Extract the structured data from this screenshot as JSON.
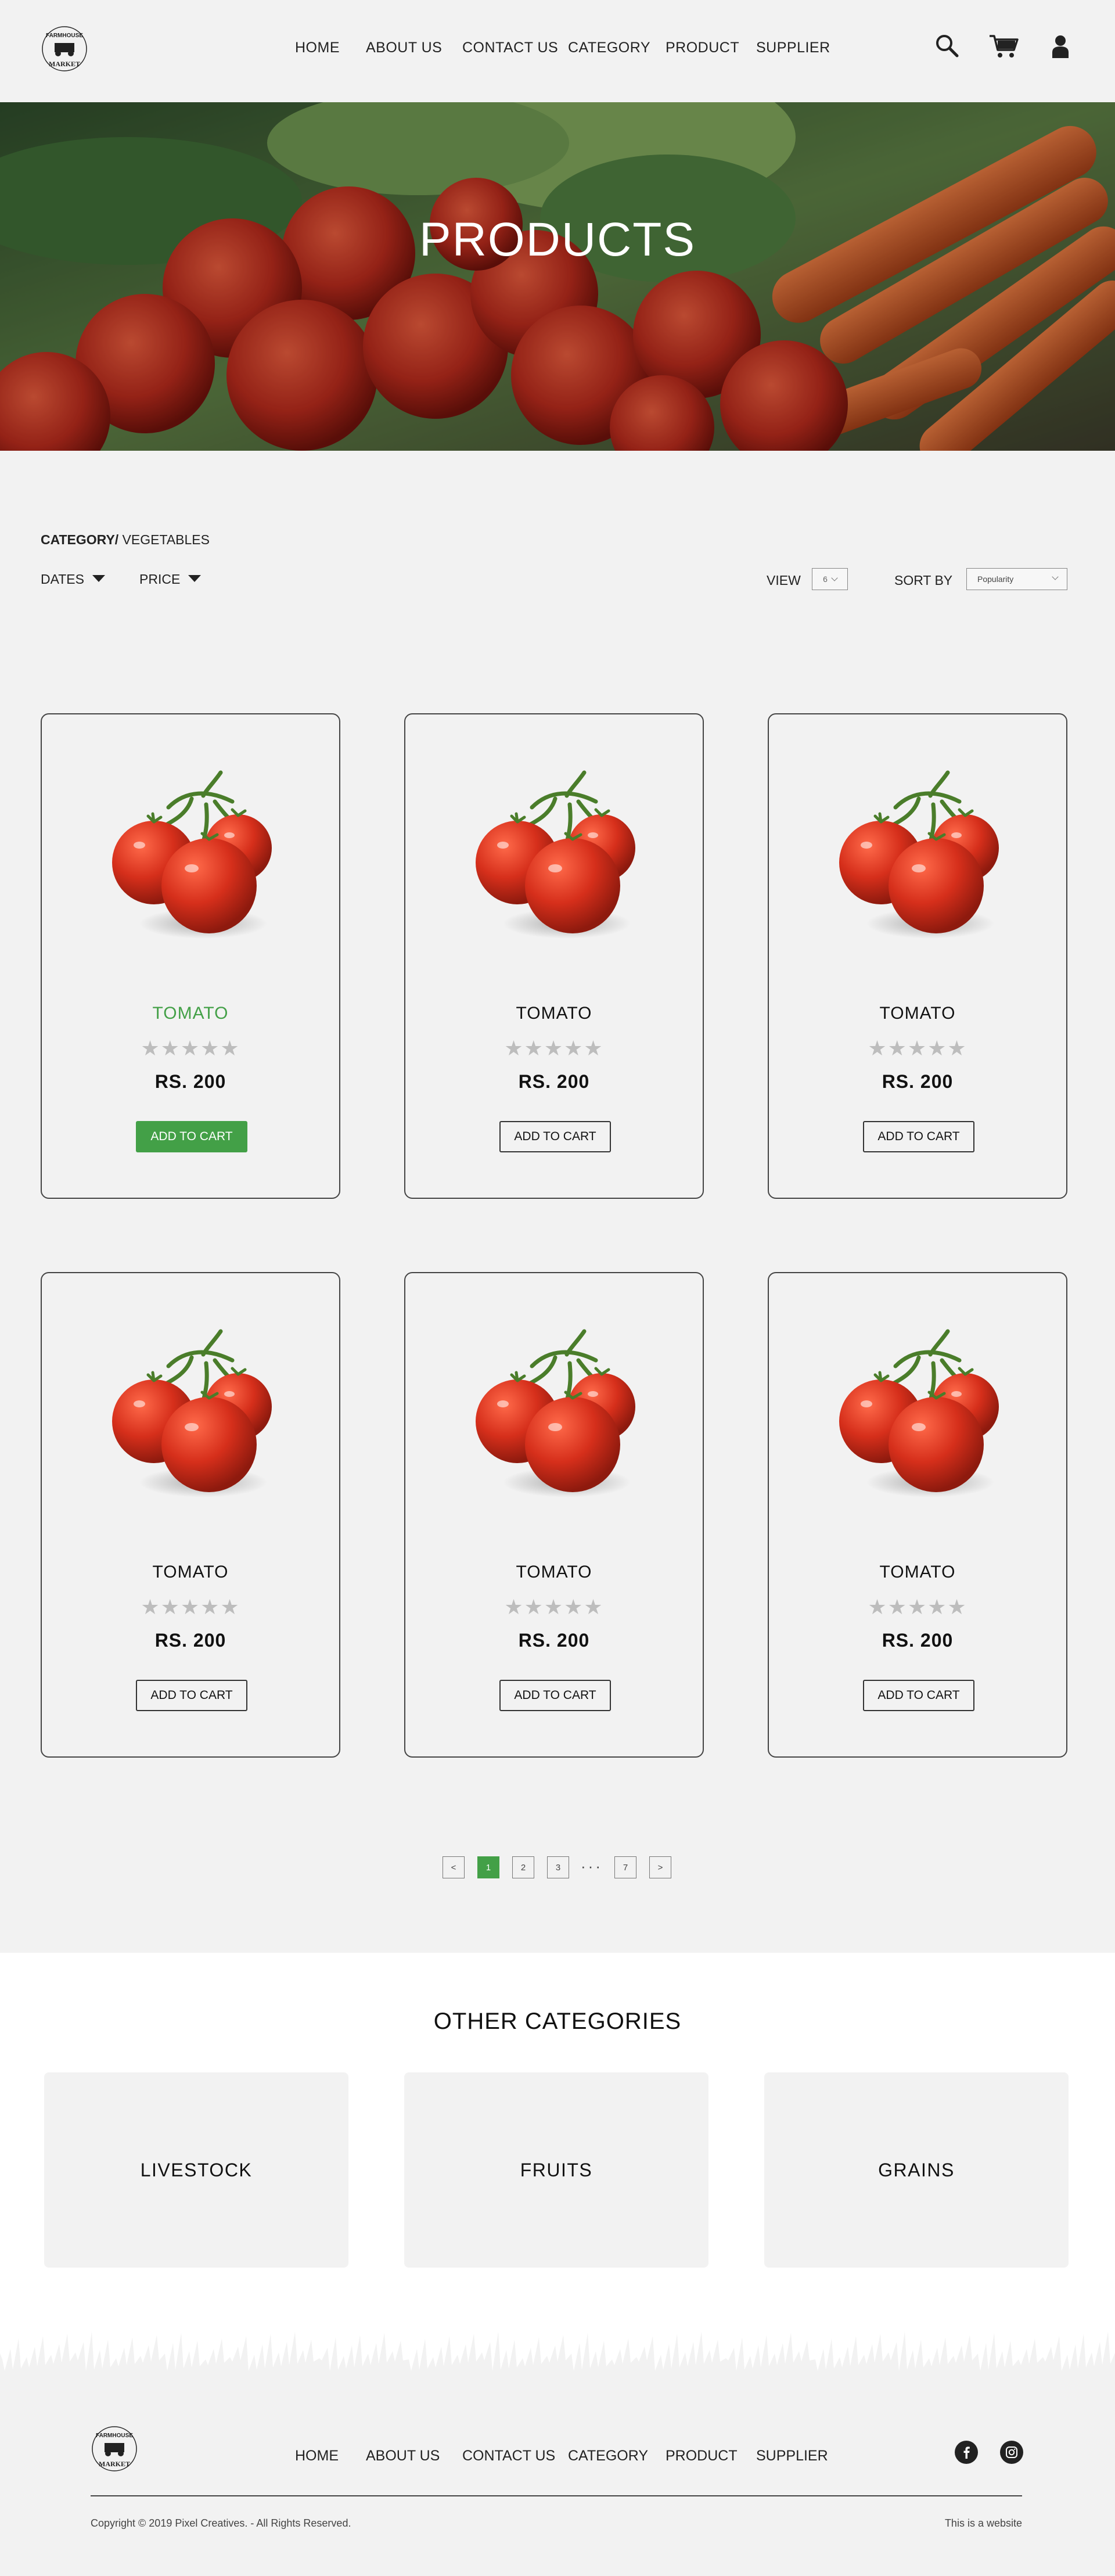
{
  "brand": {
    "logo_top": "FARMHOUSE",
    "logo_bottom": "MARKET"
  },
  "nav": [
    "HOME",
    "ABOUT US",
    "CONTACT US",
    "CATEGORY",
    "PRODUCT",
    "SUPPLIER"
  ],
  "header_icons": [
    "search-icon",
    "cart-icon",
    "user-icon"
  ],
  "hero": {
    "title": "PRODUCTS"
  },
  "breadcrumb": {
    "label": "CATEGORY/",
    "value": " VEGETABLES"
  },
  "filters": {
    "dates": "DATES",
    "price": "PRICE"
  },
  "view": {
    "label": "VIEW",
    "value": "6"
  },
  "sort": {
    "label": "SORT BY",
    "value": "Popularity"
  },
  "products": [
    {
      "name": "TOMATO",
      "price": "RS. 200",
      "rating": 0,
      "button": "ADD TO CART",
      "highlighted": true
    },
    {
      "name": "TOMATO",
      "price": "RS. 200",
      "rating": 0,
      "button": "ADD TO CART",
      "highlighted": false
    },
    {
      "name": "TOMATO",
      "price": "RS. 200",
      "rating": 0,
      "button": "ADD TO CART",
      "highlighted": false
    },
    {
      "name": "TOMATO",
      "price": "RS. 200",
      "rating": 0,
      "button": "ADD TO CART",
      "highlighted": false
    },
    {
      "name": "TOMATO",
      "price": "RS. 200",
      "rating": 0,
      "button": "ADD TO CART",
      "highlighted": false
    },
    {
      "name": "TOMATO",
      "price": "RS. 200",
      "rating": 0,
      "button": "ADD TO CART",
      "highlighted": false
    }
  ],
  "stars_text": "★★★★★",
  "pagination": {
    "prev": "<",
    "pages": [
      "1",
      "2",
      "3"
    ],
    "dots": "···",
    "last": "7",
    "next": ">",
    "current": "1"
  },
  "other_categories": {
    "title": "OTHER CATEGORIES",
    "items": [
      "LIVESTOCK",
      "FRUITS",
      "GRAINS"
    ]
  },
  "footer": {
    "nav": [
      "HOME",
      "ABOUT US",
      "CONTACT US",
      "CATEGORY",
      "PRODUCT",
      "SUPPLIER"
    ],
    "social": [
      "facebook-icon",
      "instagram-icon"
    ],
    "copyright": "Copyright © 2019 Pixel Creatives. - All Rights Reserved.",
    "right_text": "This is a website"
  },
  "colors": {
    "accent": "#43a047",
    "background": "#f2f2f2",
    "text": "#111111",
    "star": "#bdbdbd"
  }
}
